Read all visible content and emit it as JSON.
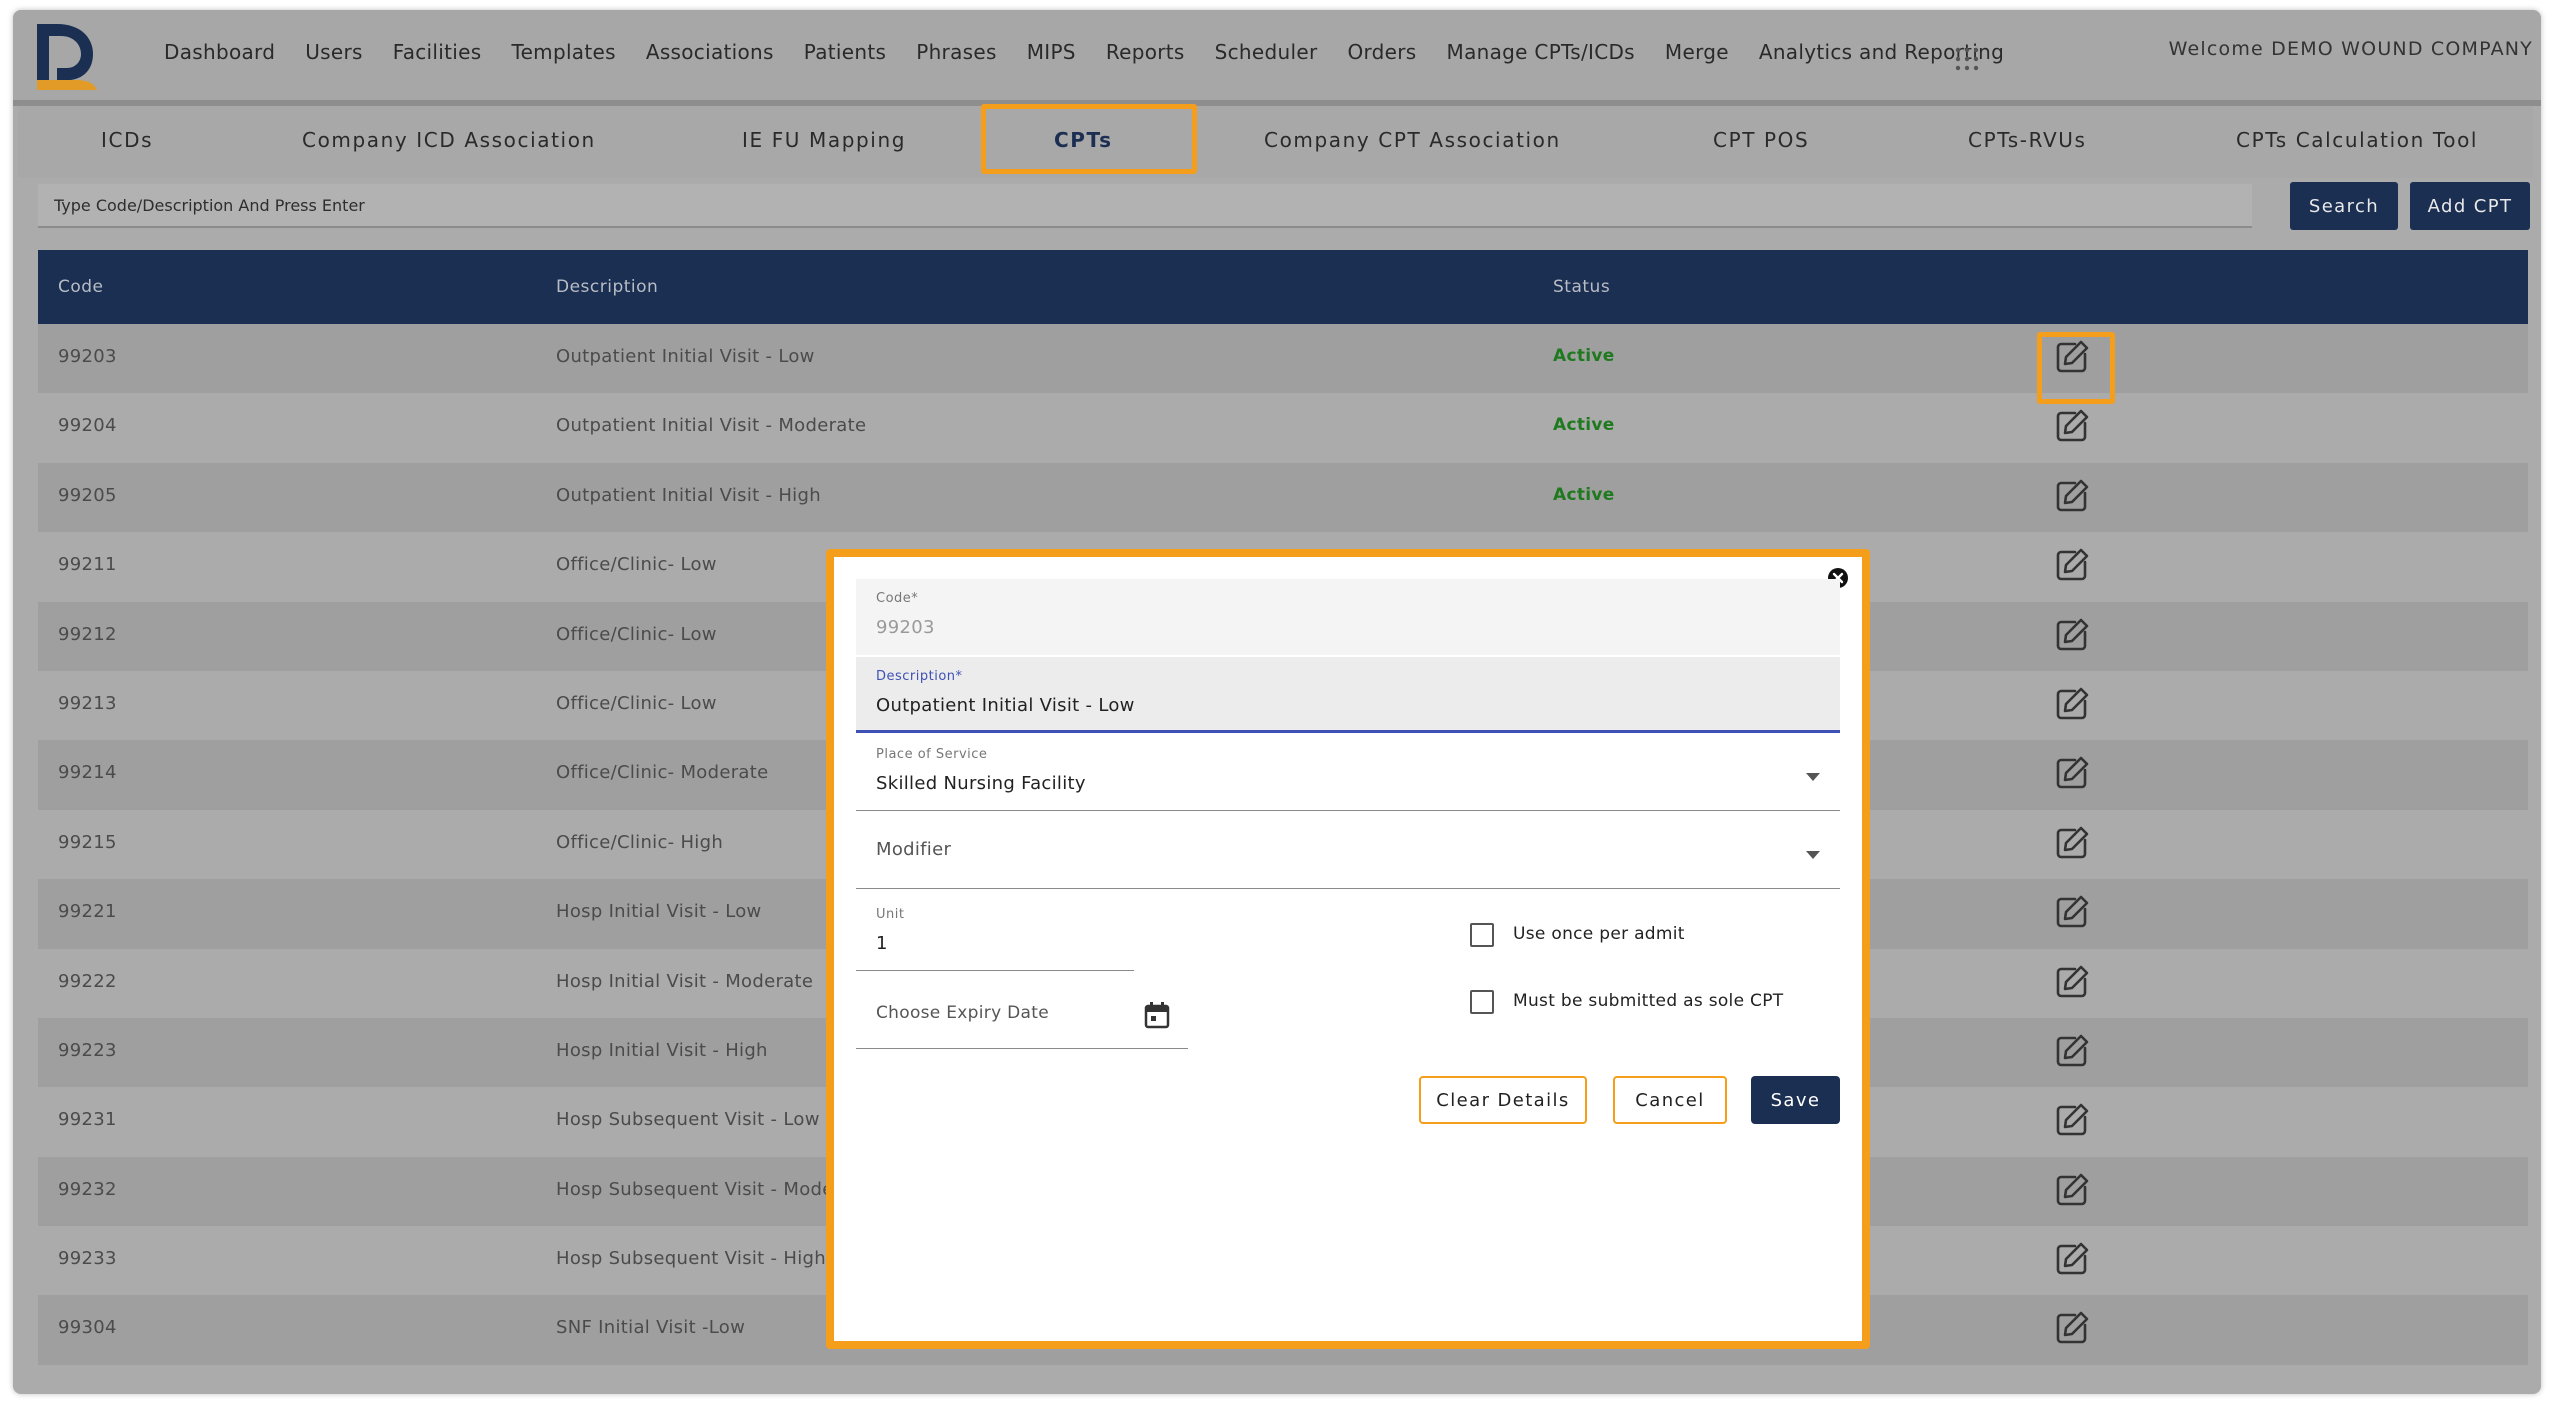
{
  "nav": {
    "items": [
      "Dashboard",
      "Users",
      "Facilities",
      "Templates",
      "Associations",
      "Patients",
      "Phrases",
      "MIPS",
      "Reports",
      "Scheduler",
      "Orders",
      "Manage CPTs/ICDs",
      "Merge",
      "Analytics and Reporting"
    ],
    "welcome": "Welcome DEMO WOUND COMPANY",
    "logo_letter": "D",
    "logo_colors": {
      "navy": "#1b2f52",
      "orange": "#e39b28"
    }
  },
  "subtabs": {
    "items": [
      "ICDs",
      "Company ICD Association",
      "IE FU Mapping",
      "CPTs",
      "Company CPT Association",
      "CPT POS",
      "CPTs-RVUs",
      "CPTs Calculation Tool"
    ],
    "active": "CPTs"
  },
  "search": {
    "placeholder": "Type Code/Description And Press Enter",
    "search_label": "Search",
    "add_label": "Add CPT"
  },
  "table": {
    "headers": [
      "Code",
      "Description",
      "Status"
    ],
    "rows": [
      {
        "code": "99203",
        "description": "Outpatient Initial Visit - Low",
        "status": "Active"
      },
      {
        "code": "99204",
        "description": "Outpatient Initial Visit - Moderate",
        "status": "Active"
      },
      {
        "code": "99205",
        "description": "Outpatient Initial Visit - High",
        "status": "Active"
      },
      {
        "code": "99211",
        "description": "Office/Clinic- Low",
        "status": ""
      },
      {
        "code": "99212",
        "description": "Office/Clinic- Low",
        "status": ""
      },
      {
        "code": "99213",
        "description": "Office/Clinic- Low",
        "status": ""
      },
      {
        "code": "99214",
        "description": "Office/Clinic- Moderate",
        "status": ""
      },
      {
        "code": "99215",
        "description": "Office/Clinic- High",
        "status": ""
      },
      {
        "code": "99221",
        "description": "Hosp Initial Visit - Low",
        "status": ""
      },
      {
        "code": "99222",
        "description": "Hosp Initial Visit - Moderate",
        "status": ""
      },
      {
        "code": "99223",
        "description": "Hosp Initial Visit - High",
        "status": ""
      },
      {
        "code": "99231",
        "description": "Hosp Subsequent Visit - Low",
        "status": ""
      },
      {
        "code": "99232",
        "description": "Hosp Subsequent Visit - Mode",
        "status": ""
      },
      {
        "code": "99233",
        "description": "Hosp Subsequent Visit - High",
        "status": ""
      },
      {
        "code": "99304",
        "description": "SNF Initial Visit -Low",
        "status": ""
      }
    ]
  },
  "modal": {
    "code_label": "Code*",
    "code_value": "99203",
    "description_label": "Description*",
    "description_value": "Outpatient Initial Visit - Low",
    "pos_label": "Place of Service",
    "pos_value": "Skilled Nursing Facility",
    "modifier_placeholder": "Modifier",
    "unit_label": "Unit",
    "unit_value": "1",
    "expiry_placeholder": "Choose Expiry Date",
    "use_once_label": "Use once per admit",
    "sole_cpt_label": "Must be submitted as sole CPT",
    "clear_label": "Clear Details",
    "cancel_label": "Cancel",
    "save_label": "Save"
  },
  "colors": {
    "navy": "#1b2f52",
    "highlight": "#f59e1c",
    "active_status": "#1f7a1f",
    "focus": "#3f51b5"
  }
}
